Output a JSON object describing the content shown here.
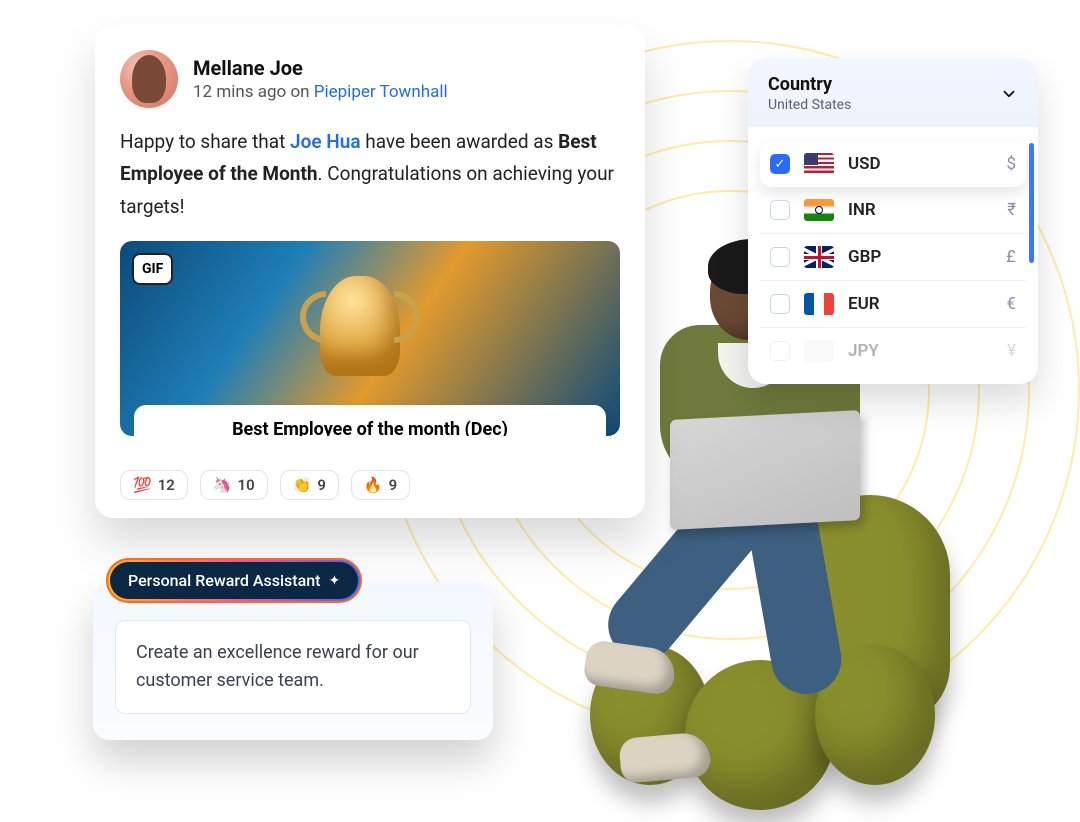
{
  "post": {
    "author": "Mellane Joe",
    "time": "12 mins ago",
    "on_word": "on",
    "channel": "Piepiper Townhall",
    "body_before": "Happy to share that ",
    "mention": "Joe Hua",
    "body_mid": " have been awarded as ",
    "bold": "Best Employee of the Month",
    "body_after": ". Congratulations on achieving your targets!",
    "gif_badge": "GIF",
    "caption": "Best Employee of the month (Dec)",
    "reactions": [
      {
        "emoji": "💯",
        "count": "12"
      },
      {
        "emoji": "🦄",
        "count": "10"
      },
      {
        "emoji": "👏",
        "count": "9"
      },
      {
        "emoji": "🔥",
        "count": "9"
      }
    ]
  },
  "country_picker": {
    "label": "Country",
    "value": "United States",
    "currencies": [
      {
        "code": "USD",
        "symbol": "$",
        "flag": "us",
        "selected": true
      },
      {
        "code": "INR",
        "symbol": "₹",
        "flag": "in",
        "selected": false
      },
      {
        "code": "GBP",
        "symbol": "£",
        "flag": "gb",
        "selected": false
      },
      {
        "code": "EUR",
        "symbol": "€",
        "flag": "fr",
        "selected": false
      },
      {
        "code": "JPY",
        "symbol": "¥",
        "flag": "none",
        "selected": false
      }
    ]
  },
  "assistant": {
    "chip_label": "Personal Reward Assistant",
    "prompt": "Create an excellence reward for our customer service team."
  }
}
